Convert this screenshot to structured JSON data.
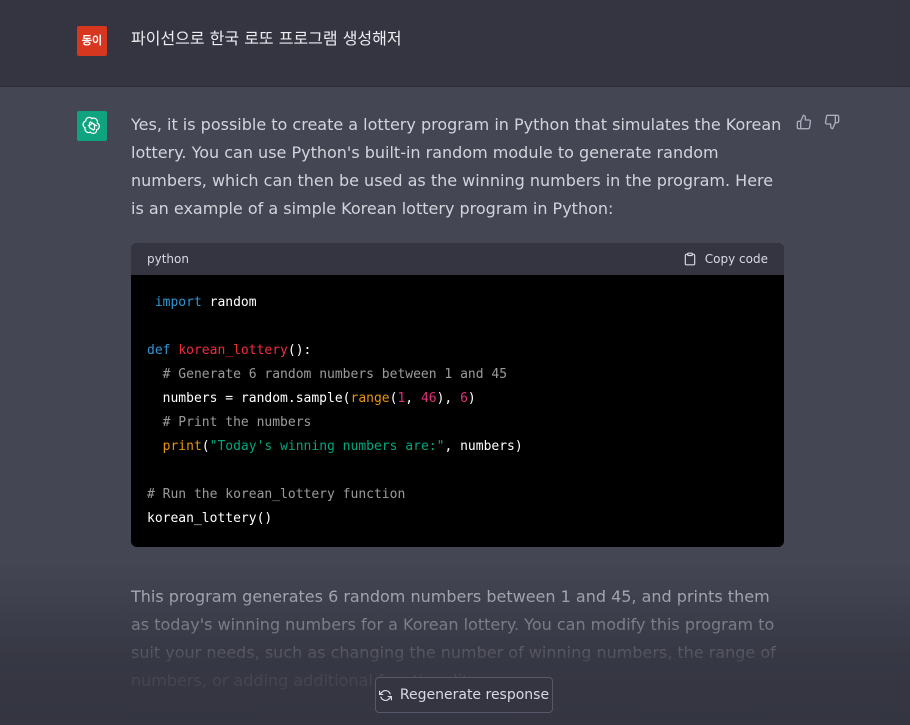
{
  "user_message": {
    "avatar_text": "동이",
    "text": "파이선으로 한국 로또 프로그램 생성해저"
  },
  "assistant_message": {
    "paragraph_1": "Yes, it is possible to create a lottery program in Python that simulates the Korean lottery. You can use Python's built-in random module to generate random numbers, which can then be used as the winning numbers in the program. Here is an example of a simple Korean lottery program in Python:",
    "code_block": {
      "language": "python",
      "copy_label": "Copy code",
      "lines": [
        "import random",
        "",
        "def korean_lottery():",
        "  # Generate 6 random numbers between 1 and 45",
        "  numbers = random.sample(range(1, 46), 6)",
        "  # Print the numbers",
        "  print(\"Today's winning numbers are:\", numbers)",
        "",
        "# Run the korean_lottery function",
        "korean_lottery()"
      ]
    },
    "paragraph_2": "This program generates 6 random numbers between 1 and 45, and prints them as today's winning numbers for a Korean lottery. You can modify this program to suit your needs, such as changing the number of winning numbers, the range of numbers, or adding additional functionality."
  },
  "actions": {
    "regenerate_label": "Regenerate response",
    "thumbs_up_icon": "thumbs-up-icon",
    "thumbs_down_icon": "thumbs-down-icon"
  },
  "colors": {
    "user_avatar_bg": "#d8371f",
    "bot_avatar_bg": "#10a37f",
    "page_bg": "#444654",
    "user_row_bg": "#343541"
  }
}
